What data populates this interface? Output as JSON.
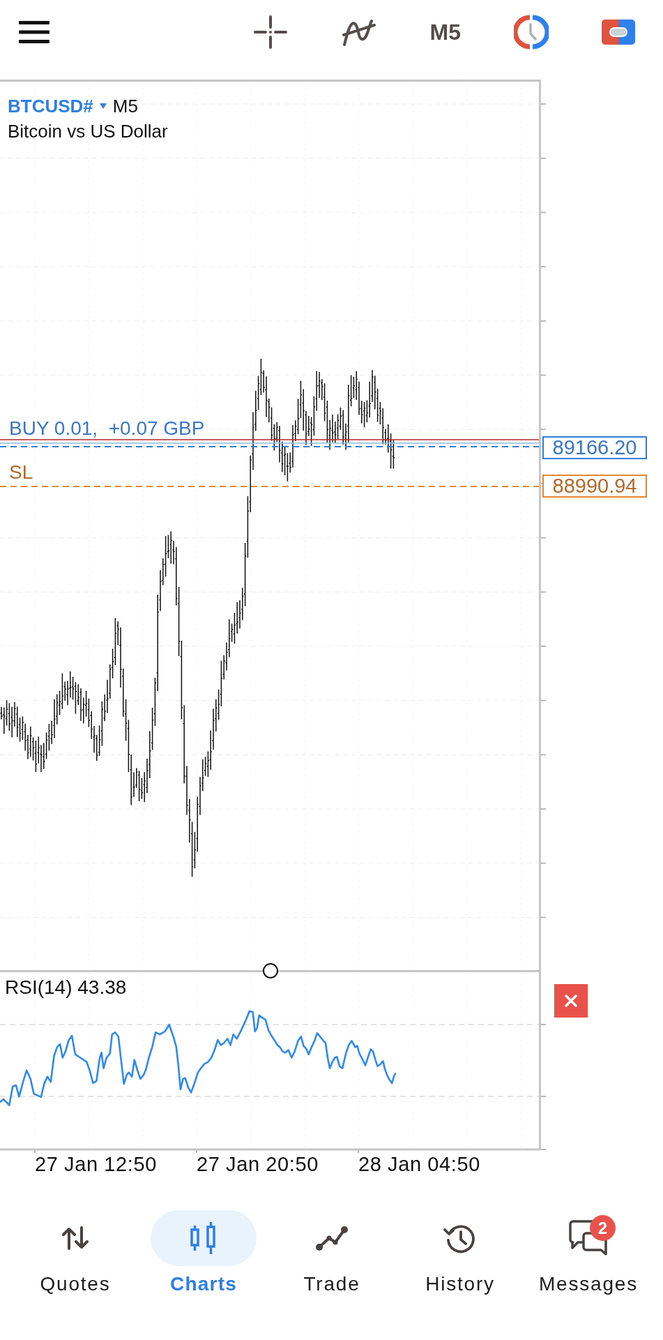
{
  "top_bar": {
    "timeframe": "M5"
  },
  "chart": {
    "symbol": "BTCUSD#",
    "timeframe": "M5",
    "description": "Bitcoin vs US Dollar",
    "levels": [
      {
        "kind": "position",
        "label": "BUY 0.01,  +0.07 GBP",
        "price": "89166.20"
      },
      {
        "kind": "stop_loss",
        "label": "SL",
        "price": "88990.94"
      }
    ],
    "indicator": {
      "label": "RSI(14) 43.38"
    },
    "time_labels": [
      "27 Jan 12:50",
      "27 Jan 20:50",
      "28 Jan 04:50"
    ]
  },
  "nav": {
    "tabs": [
      {
        "kind": "quotes",
        "label": "Quotes",
        "selected": false
      },
      {
        "kind": "charts",
        "label": "Charts",
        "selected": true
      },
      {
        "kind": "trade",
        "label": "Trade",
        "selected": false
      },
      {
        "kind": "history",
        "label": "History",
        "selected": false
      },
      {
        "kind": "messages",
        "label": "Messages",
        "selected": false,
        "badge": "2"
      }
    ]
  }
}
